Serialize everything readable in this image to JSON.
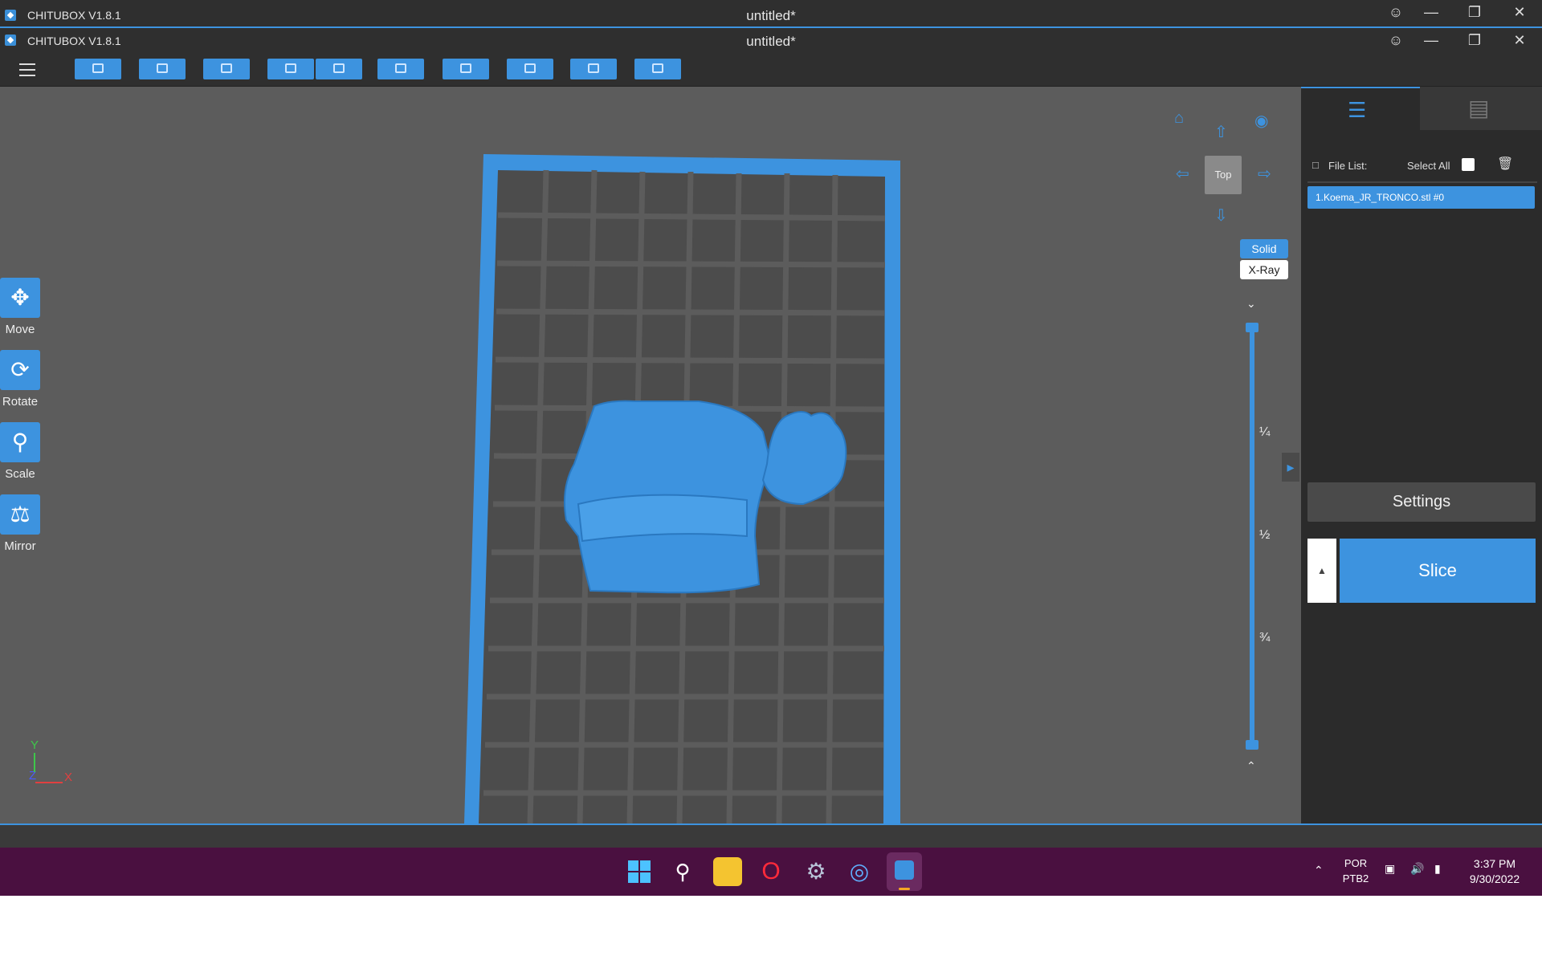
{
  "window_back": {
    "app_name": "CHITUBOX V1.8.1",
    "doc_title": "untitled*"
  },
  "window_front": {
    "app_name": "CHITUBOX V1.8.1",
    "doc_title": "untitled*"
  },
  "toolbar": {
    "buttons": [
      "open-file-icon",
      "save-icon",
      "auto-layout-icon",
      "undo-icon",
      "redo-icon",
      "copy-icon",
      "group-icon",
      "support-icon",
      "hollow-icon",
      "dig-hole-icon"
    ]
  },
  "tools": [
    {
      "label": "Move",
      "icon": "move-icon"
    },
    {
      "label": "Rotate",
      "icon": "rotate-icon"
    },
    {
      "label": "Scale",
      "icon": "scale-icon"
    },
    {
      "label": "Mirror",
      "icon": "mirror-icon"
    }
  ],
  "view": {
    "current": "Top",
    "modes": {
      "solid": "Solid",
      "xray": "X-Ray",
      "active": "Solid"
    }
  },
  "layer_slider": {
    "fractions": [
      "¼",
      "½",
      "¾"
    ]
  },
  "axis": {
    "y": "Y",
    "z": "Z",
    "x": "X"
  },
  "right_panel": {
    "file_list_label": "File List:",
    "select_all_label": "Select All",
    "files": [
      "1.Koema_JR_TRONCO.stl #0"
    ],
    "settings_label": "Settings",
    "slice_label": "Slice"
  },
  "tray": {
    "lang_line1": "POR",
    "lang_line2": "PTB2",
    "time": "3:37 PM",
    "date": "9/30/2022"
  },
  "colors": {
    "accent": "#3d93df",
    "taskbar": "#4a1040",
    "viewport": "#5c5c5c"
  }
}
